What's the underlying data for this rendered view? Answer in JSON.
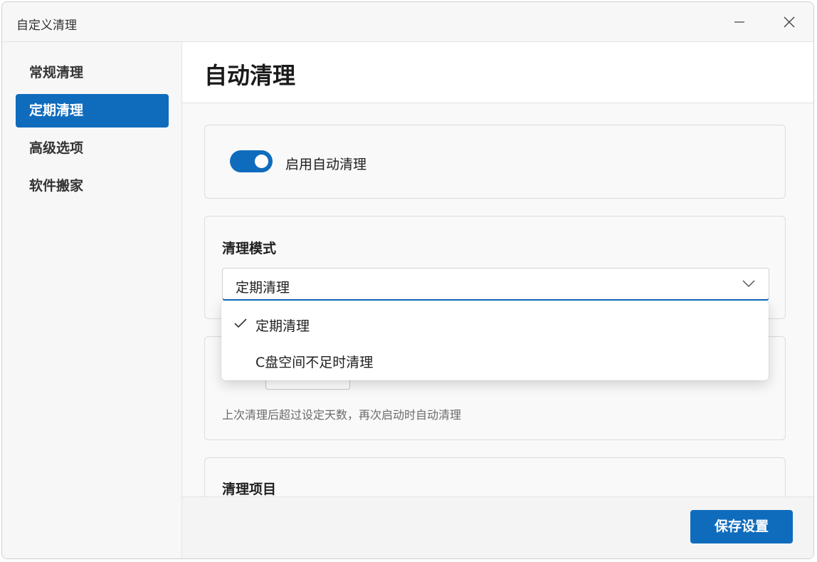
{
  "window": {
    "title": "自定义清理",
    "minimize_icon": "minimize-icon",
    "close_icon": "close-icon"
  },
  "sidebar": {
    "items": [
      {
        "label": "常规清理",
        "active": false
      },
      {
        "label": "定期清理",
        "active": true
      },
      {
        "label": "高级选项",
        "active": false
      },
      {
        "label": "软件搬家",
        "active": false
      }
    ]
  },
  "page": {
    "title": "自动清理"
  },
  "auto_clean": {
    "toggle_label": "启用自动清理",
    "enabled": true
  },
  "clean_mode": {
    "title": "清理模式",
    "selected": "定期清理",
    "options": [
      {
        "label": "定期清理",
        "checked": true
      },
      {
        "label": "C盘空间不足时清理",
        "checked": false
      }
    ]
  },
  "schedule": {
    "hint": "上次清理后超过设定天数，再次启动时自动清理"
  },
  "clean_items": {
    "title": "清理项目"
  },
  "footer": {
    "save_label": "保存设置"
  },
  "colors": {
    "accent": "#0f6cbd"
  }
}
